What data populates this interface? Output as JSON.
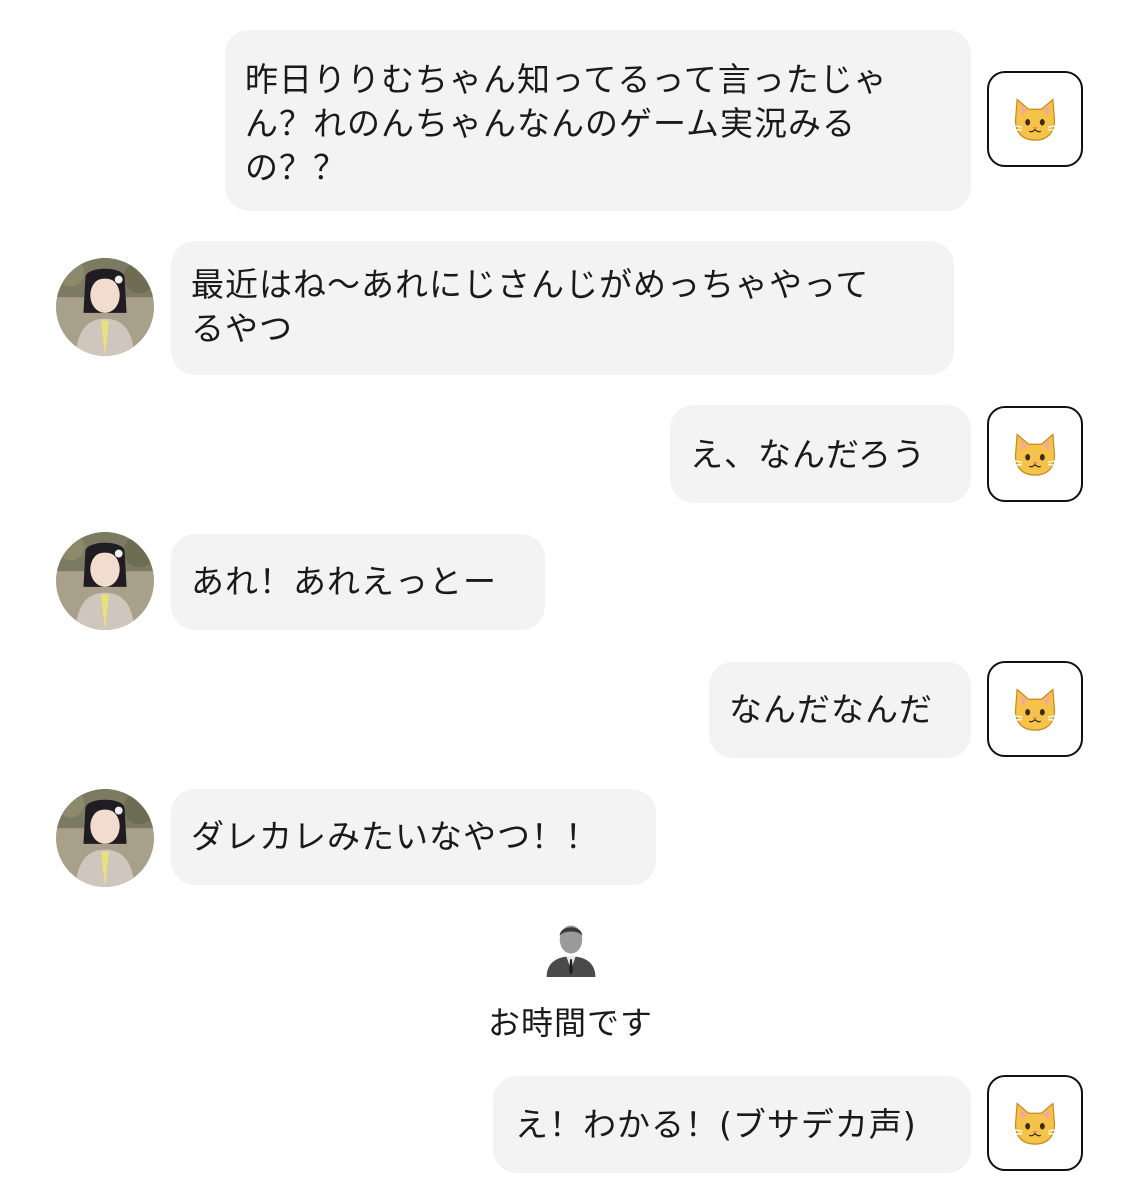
{
  "messages": [
    {
      "side": "right",
      "text": "昨日りりむちゃん知ってるって言ったじゃ\nん？れのんちゃんなんのゲーム実況みる\nの？？"
    },
    {
      "side": "left",
      "text": "最近はね〜あれにじさんじがめっちゃやって\nるやつ"
    },
    {
      "side": "right",
      "text": "え、なんだろう"
    },
    {
      "side": "left",
      "text": "あれ！あれえっとー"
    },
    {
      "side": "right",
      "text": "なんだなんだ"
    },
    {
      "side": "left",
      "text": "ダレカレみたいなやつ！！"
    },
    {
      "side": "right",
      "text": "え！わかる！(ブサデカ声)"
    }
  ],
  "system_message": {
    "icon": "person-in-suit-icon",
    "text": "お時間です"
  },
  "icons": {
    "user_avatar": "cat-face-icon",
    "other_avatar": "girl-photo-avatar"
  },
  "colors": {
    "bubble": "#f3f3f3",
    "background": "#ffffff",
    "cat": "#f6c34a"
  }
}
